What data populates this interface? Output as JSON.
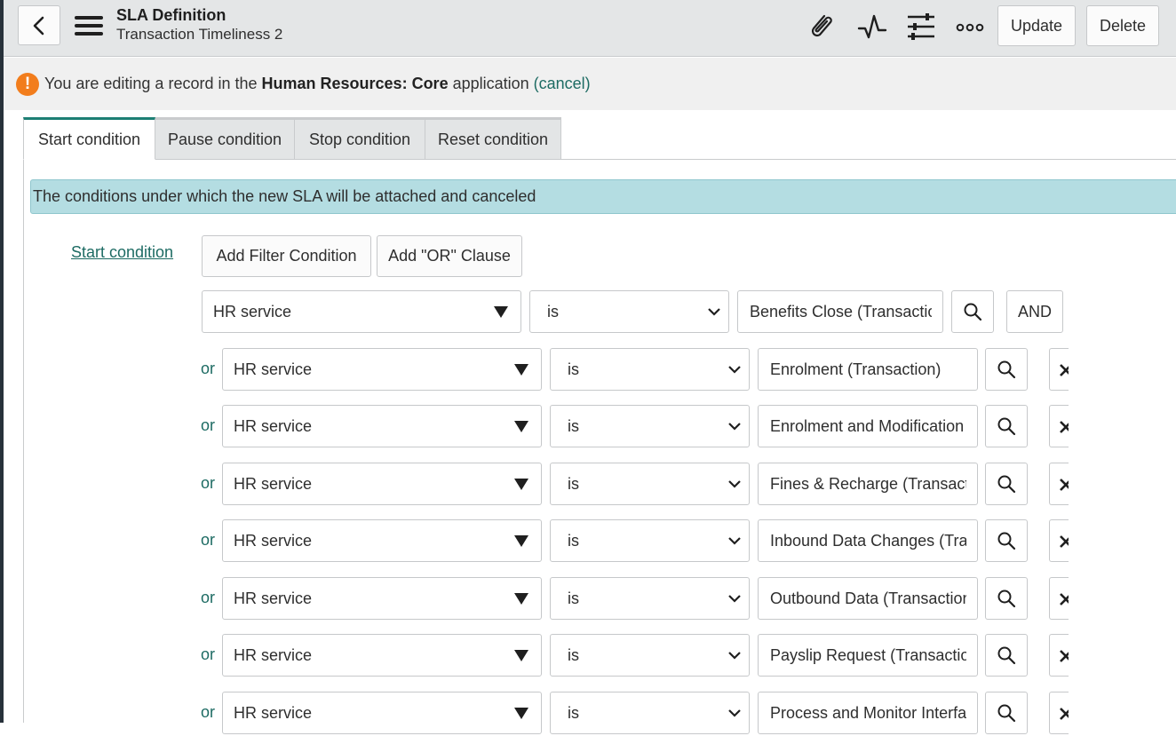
{
  "header": {
    "title": "SLA Definition",
    "subtitle": "Transaction Timeliness 2",
    "update_label": "Update",
    "delete_label": "Delete"
  },
  "banner": {
    "prefix": "You are editing a record in the ",
    "app_name": "Human Resources: Core",
    "suffix": " application ",
    "cancel": "(cancel)"
  },
  "tabs": [
    {
      "label": "Start condition",
      "active": true
    },
    {
      "label": "Pause condition",
      "active": false
    },
    {
      "label": "Stop condition",
      "active": false
    },
    {
      "label": "Reset condition",
      "active": false
    }
  ],
  "info": "The conditions under which the new SLA will be attached and canceled",
  "condition": {
    "label": "Start condition",
    "add_filter": "Add Filter Condition",
    "add_or": "Add \"OR\" Clause",
    "and_label": "AND",
    "or_label": "or"
  },
  "rows": [
    {
      "field": "HR service",
      "operator": "is",
      "value": "Benefits Close (Transaction)"
    },
    {
      "field": "HR service",
      "operator": "is",
      "value": "Enrolment (Transaction)"
    },
    {
      "field": "HR service",
      "operator": "is",
      "value": "Enrolment and Modification (Transaction)"
    },
    {
      "field": "HR service",
      "operator": "is",
      "value": "Fines & Recharge (Transaction)"
    },
    {
      "field": "HR service",
      "operator": "is",
      "value": "Inbound Data Changes (Transaction)"
    },
    {
      "field": "HR service",
      "operator": "is",
      "value": "Outbound Data (Transaction)"
    },
    {
      "field": "HR service",
      "operator": "is",
      "value": "Payslip Request (Transaction)"
    },
    {
      "field": "HR service",
      "operator": "is",
      "value": "Process and Monitor Interfaces (Transaction)"
    }
  ],
  "icons": [
    "back-icon",
    "menu-icon",
    "paperclip-icon",
    "activity-icon",
    "settings-sliders-icon",
    "more-icon",
    "warning-icon",
    "search-icon",
    "close-icon",
    "chevron-down-icon"
  ],
  "colors": {
    "accent": "#1d7f74",
    "link": "#1d6b63",
    "info_bg": "#b4dde2",
    "warning": "#f27d1c"
  }
}
